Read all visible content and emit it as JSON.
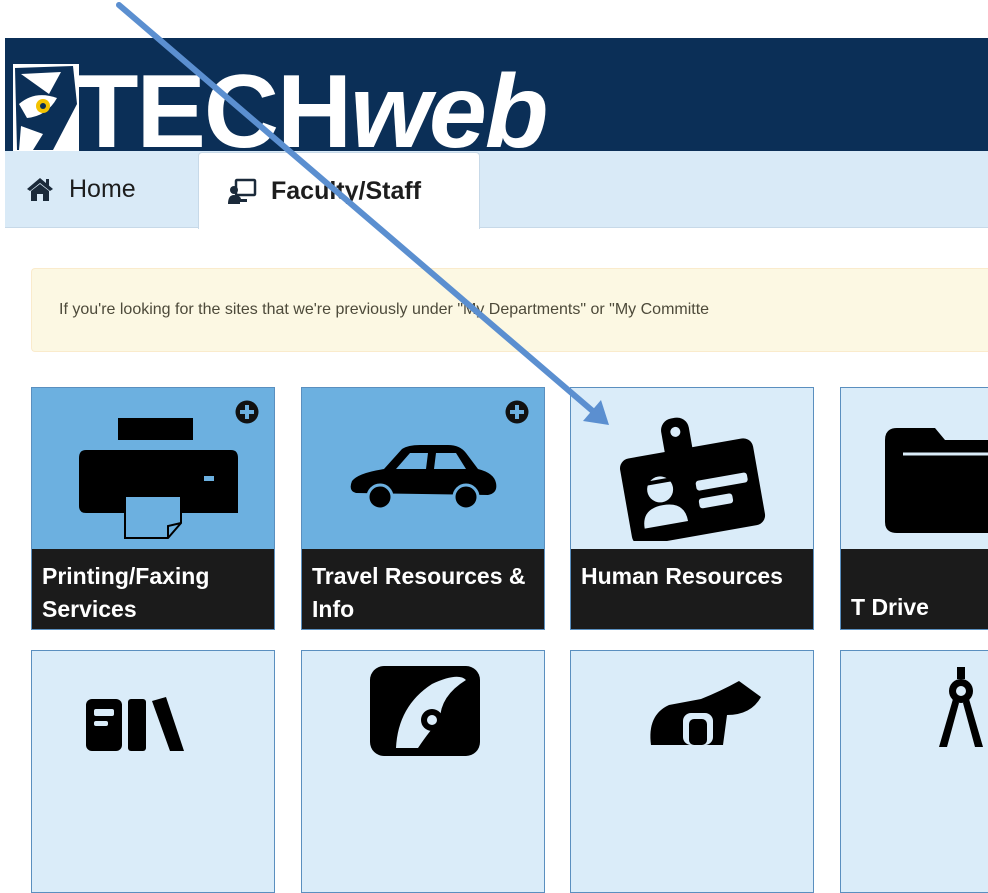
{
  "banner": {
    "brand_part1": "TECH",
    "brand_part2": "web"
  },
  "nav": {
    "tabs": [
      {
        "label": "Home"
      },
      {
        "label": "Faculty/Staff"
      }
    ]
  },
  "alert": {
    "text": "If you're looking for the sites that we're previously under \"My Departments\" or \"My Committe"
  },
  "tiles": [
    {
      "label": "Printing/Faxing Services",
      "icon": "printer-icon",
      "expandable": true
    },
    {
      "label": "Travel Resources & Info",
      "icon": "car-icon",
      "expandable": true
    },
    {
      "label": "Human Resources",
      "icon": "id-badge-icon",
      "expandable": false
    },
    {
      "label": "T Drive",
      "icon": "folder-icon",
      "expandable": false
    },
    {
      "label": "",
      "icon": "books-icon"
    },
    {
      "label": "",
      "icon": "owl-logo-icon"
    },
    {
      "label": "",
      "icon": "handshake-icon"
    },
    {
      "label": "",
      "icon": "compass-icon"
    }
  ],
  "annotation": {
    "arrow": "pointer-arrow",
    "color": "#5b8fd0"
  },
  "colors": {
    "banner": "#0b2f57",
    "nav": "#d9eaf7",
    "tile_active": "#6cb0e0",
    "tile_default": "#daecf9",
    "label_bg": "#1b1b1b"
  }
}
